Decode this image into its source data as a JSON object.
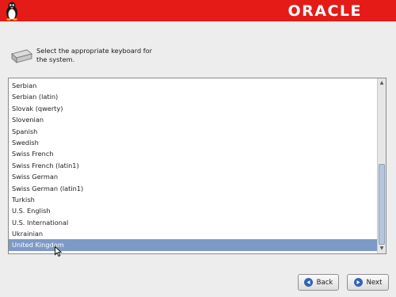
{
  "header": {
    "logo_text": "ORACLE",
    "brand_color": "#e41b17",
    "icon": "tux-penguin-icon"
  },
  "prompt": {
    "text_line1": "Select the appropriate keyboard for",
    "text_line2": "the system.",
    "icon": "keyboard-icon"
  },
  "keyboards": {
    "items": [
      "Serbian",
      "Serbian (latin)",
      "Slovak (qwerty)",
      "Slovenian",
      "Spanish",
      "Swedish",
      "Swiss French",
      "Swiss French (latin1)",
      "Swiss German",
      "Swiss German (latin1)",
      "Turkish",
      "U.S. English",
      "U.S. International",
      "Ukrainian",
      "United Kingdom"
    ],
    "selected": "United Kingdom",
    "selection_color": "#7d9ac6"
  },
  "buttons": {
    "back_label": "Back",
    "next_label": "Next",
    "back_icon": "arrow-left-icon",
    "next_icon": "arrow-right-icon"
  }
}
